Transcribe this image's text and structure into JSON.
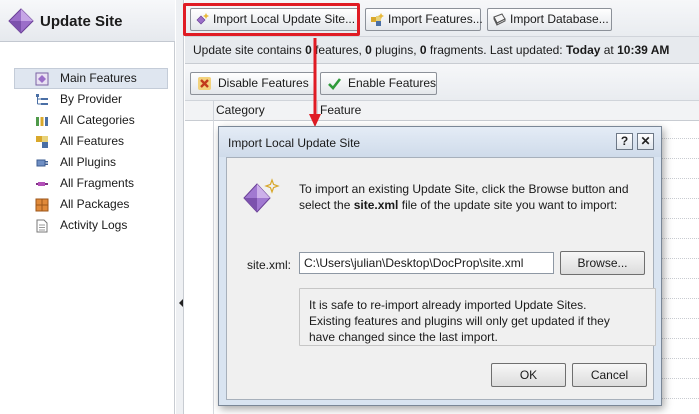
{
  "app": {
    "title": "Update Site",
    "icon": "update-site-gem-icon"
  },
  "sidebar": {
    "items": [
      {
        "label": "Main Features",
        "icon": "main-features-icon",
        "selected": true
      },
      {
        "label": "By Provider",
        "icon": "provider-tree-icon",
        "selected": false
      },
      {
        "label": "All Categories",
        "icon": "categories-icon",
        "selected": false
      },
      {
        "label": "All Features",
        "icon": "features-icon",
        "selected": false
      },
      {
        "label": "All Plugins",
        "icon": "plugins-icon",
        "selected": false
      },
      {
        "label": "All Fragments",
        "icon": "fragments-icon",
        "selected": false
      },
      {
        "label": "All Packages",
        "icon": "packages-icon",
        "selected": false
      },
      {
        "label": "Activity Logs",
        "icon": "activity-log-icon",
        "selected": false
      }
    ]
  },
  "toolbar": {
    "import_update_site": "Import Local Update Site...",
    "import_features": "Import Features...",
    "import_database": "Import Database..."
  },
  "info_bar": {
    "prefix": "Update site contains ",
    "features_count": "0",
    "features_word": " features, ",
    "plugins_count": "0",
    "plugins_word": " plugins, ",
    "fragments_count": "0",
    "fragments_word": " fragments. Last updated: ",
    "day": "Today",
    "at_word": " at ",
    "time": "10:39 AM"
  },
  "feature_toolbar": {
    "disable": "Disable Features",
    "enable": "Enable Features"
  },
  "table": {
    "columns": [
      "Category",
      "Feature"
    ]
  },
  "dialog": {
    "title": "Import Local Update Site",
    "help_button": "?",
    "close_button": "✕",
    "intro_before": "To import an existing Update Site, click the Browse button and select the ",
    "intro_bold": "site.xml",
    "intro_after": " file of the update site you want to import:",
    "field_label": "site.xml:",
    "path_value": "C:\\Users\\julian\\Desktop\\DocProp\\site.xml",
    "browse": "Browse...",
    "note_lines": [
      "It is safe to re-import already imported Update Sites.",
      "Existing features and plugins will only get updated if they",
      "have changed since the last import."
    ],
    "ok": "OK",
    "cancel": "Cancel"
  },
  "colors": {
    "highlight": "#e01b24",
    "dialog_frame": "#d9e4f1",
    "selected_item": "#dfe6f0"
  }
}
